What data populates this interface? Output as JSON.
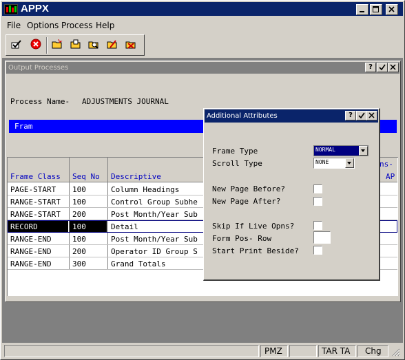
{
  "app": {
    "title": "APPX"
  },
  "menu": {
    "file": "File",
    "options": "Options",
    "process": "Process",
    "help": "Help"
  },
  "toolbar": {
    "icons": [
      "check-icon",
      "cancel-icon",
      "new-folder-icon",
      "open-folder-icon",
      "search-folder-icon",
      "edit-folder-icon",
      "delete-folder-icon"
    ]
  },
  "output_window": {
    "title": "Output Processes",
    "process_name_label": "Process Name-",
    "process_name_value": "ADJUSTMENTS JOURNAL",
    "frame_header": "Fram",
    "table": {
      "headers": {
        "frame_class": "Frame Class",
        "seq_no": "Seq No",
        "descriptive": "Descriptive",
        "trans_top": "ns-",
        "ap": "AP"
      },
      "rows": [
        {
          "frame_class": "PAGE-START",
          "seq_no": "100",
          "descriptive": "Column Headings"
        },
        {
          "frame_class": "RANGE-START",
          "seq_no": "100",
          "descriptive": "Control Group Subhe"
        },
        {
          "frame_class": "RANGE-START",
          "seq_no": "200",
          "descriptive": "Post Month/Year Sub"
        },
        {
          "frame_class": "RECORD",
          "seq_no": "100",
          "descriptive": "Detail"
        },
        {
          "frame_class": "RANGE-END",
          "seq_no": "100",
          "descriptive": "Post Month/Year Sub"
        },
        {
          "frame_class": "RANGE-END",
          "seq_no": "200",
          "descriptive": "Operator ID Group S"
        },
        {
          "frame_class": "RANGE-END",
          "seq_no": "300",
          "descriptive": "Grand Totals"
        }
      ]
    }
  },
  "dialog": {
    "title": "Additional Attributes",
    "frame_type_label": "Frame Type",
    "frame_type_value": "NORMAL",
    "scroll_type_label": "Scroll Type",
    "scroll_type_value": "NONE",
    "new_page_before_label": "New Page Before?",
    "new_page_after_label": "New Page After?",
    "skip_if_live_label": "Skip If Live Opns?",
    "form_pos_row_label": "Form Pos- Row",
    "start_print_beside_label": "Start Print Beside?"
  },
  "statusbar": {
    "pmz": "PMZ",
    "tar_ta": "TAR TA",
    "chg": "Chg"
  },
  "colors": {
    "title_active": "#0a246a",
    "title_inactive": "#808080",
    "highlight": "#0000ff",
    "selected_row": "#000000"
  }
}
